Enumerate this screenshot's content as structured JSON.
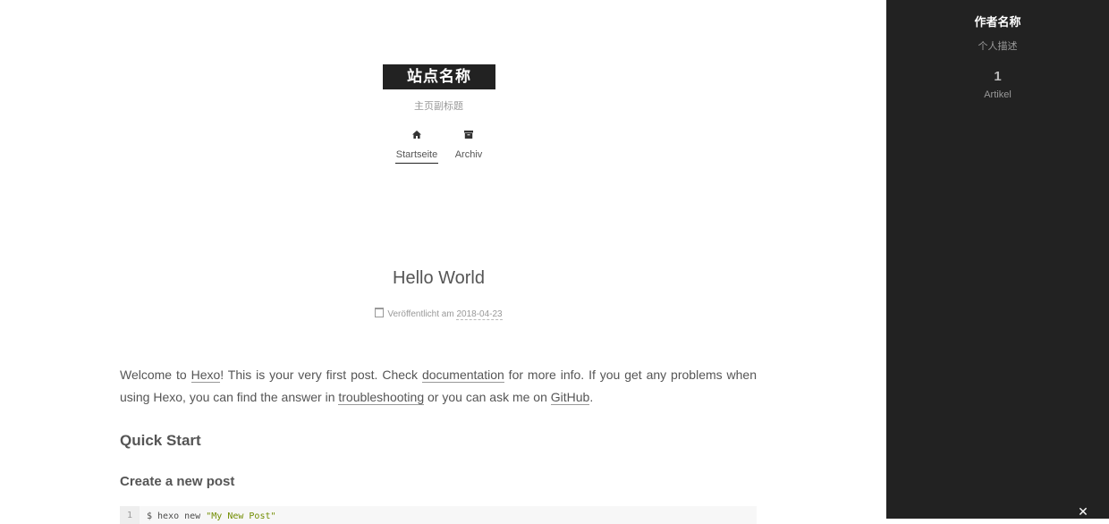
{
  "header": {
    "site_name": "站点名称",
    "subtitle": "主页副标题",
    "nav": [
      {
        "label": "Startseite",
        "icon": "home-icon",
        "active": true
      },
      {
        "label": "Archiv",
        "icon": "archive-icon",
        "active": false
      }
    ]
  },
  "post": {
    "title": "Hello World",
    "meta_label": "Veröffentlicht am",
    "date": "2018-04-23",
    "intro": {
      "t1": "Welcome to ",
      "link_hexo": "Hexo",
      "t2": "! This is your very first post. Check ",
      "link_docs": "documentation",
      "t3": " for more info. If you get any problems when using Hexo, you can find the answer in ",
      "link_trouble": "troubleshooting",
      "t4": " or you can ask me on ",
      "link_github": "GitHub",
      "t5": "."
    },
    "h2": "Quick Start",
    "h3": "Create a new post",
    "code": {
      "line_no": "1",
      "cmd": "$ hexo new ",
      "arg": "\"My New Post\""
    }
  },
  "sidebar": {
    "author_name": "作者名称",
    "author_desc": "个人描述",
    "posts_count": "1",
    "posts_label": "Artikel",
    "close_icon": "close-icon"
  },
  "colors": {
    "sidebar_bg": "#222222",
    "brand_bg": "#222222",
    "text": "#555555",
    "muted": "#999999"
  }
}
